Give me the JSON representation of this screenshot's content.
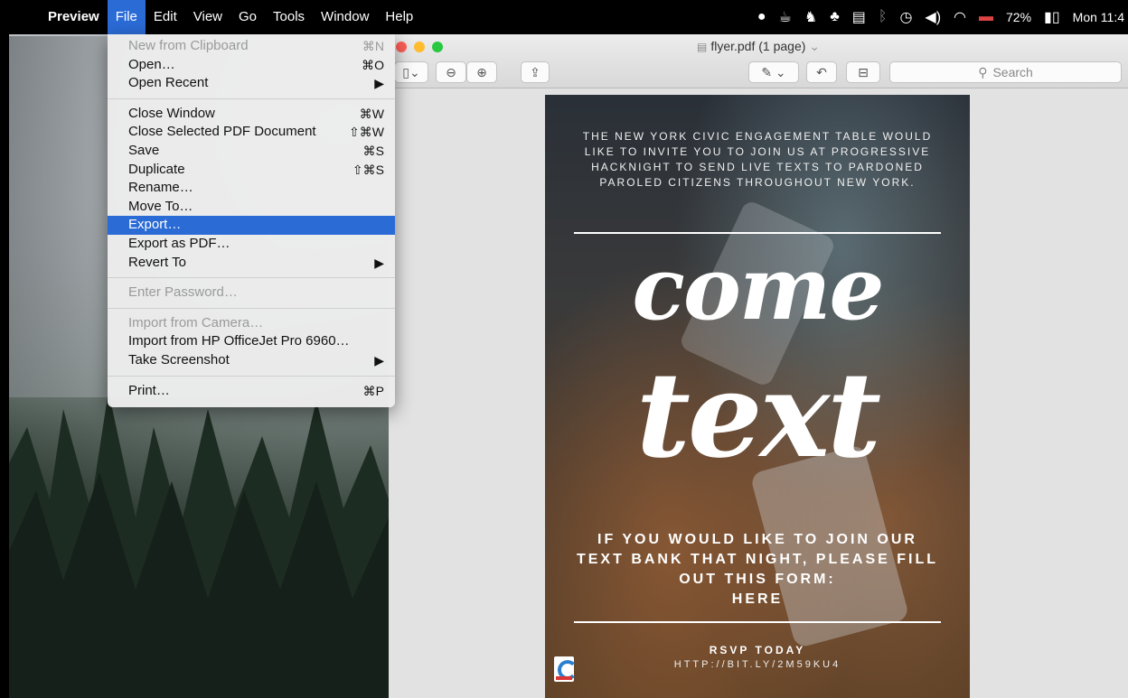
{
  "menubar": {
    "apple_icon": "apple-icon",
    "items": [
      "Preview",
      "File",
      "Edit",
      "View",
      "Go",
      "Tools",
      "Window",
      "Help"
    ],
    "battery": "72%",
    "clock": "Mon 11:4"
  },
  "window": {
    "title": "flyer.pdf (1 page)",
    "search_placeholder": "Search"
  },
  "file_menu": {
    "groups": [
      [
        {
          "label": "New from Clipboard",
          "shortcut": "⌘N",
          "disabled": true
        },
        {
          "label": "Open…",
          "shortcut": "⌘O"
        },
        {
          "label": "Open Recent",
          "shortcut": "▶"
        }
      ],
      [
        {
          "label": "Close Window",
          "shortcut": "⌘W"
        },
        {
          "label": "Close Selected PDF Document",
          "shortcut": "⇧⌘W"
        },
        {
          "label": "Save",
          "shortcut": "⌘S"
        },
        {
          "label": "Duplicate",
          "shortcut": "⇧⌘S"
        },
        {
          "label": "Rename…",
          "shortcut": ""
        },
        {
          "label": "Move To…",
          "shortcut": ""
        },
        {
          "label": "Export…",
          "shortcut": "",
          "highlighted": true
        },
        {
          "label": "Export as PDF…",
          "shortcut": ""
        },
        {
          "label": "Revert To",
          "shortcut": "▶"
        }
      ],
      [
        {
          "label": "Enter Password…",
          "shortcut": "",
          "disabled": true
        }
      ],
      [
        {
          "label": "Import from Camera…",
          "shortcut": "",
          "disabled": true
        },
        {
          "label": "Import from HP OfficeJet Pro 6960…",
          "shortcut": ""
        },
        {
          "label": "Take Screenshot",
          "shortcut": "▶"
        }
      ],
      [
        {
          "label": "Print…",
          "shortcut": "⌘P"
        }
      ]
    ]
  },
  "flyer": {
    "intro": "THE NEW YORK CIVIC ENGAGEMENT TABLE WOULD LIKE TO INVITE YOU TO JOIN US AT PROGRESSIVE HACKNIGHT TO SEND LIVE TEXTS TO PARDONED PAROLED CITIZENS THROUGHOUT NEW YORK.",
    "headline_1": "come",
    "headline_2": "text",
    "cta": "IF YOU WOULD LIKE TO JOIN OUR TEXT BANK THAT NIGHT, PLEASE FILL OUT THIS FORM:",
    "cta_link": "HERE",
    "rsvp": "RSVP TODAY",
    "url": "HTTP://BIT.LY/2M59KU4"
  },
  "colors": {
    "menu_highlight": "#2b6bd6",
    "menubar_bg": "#000000"
  }
}
